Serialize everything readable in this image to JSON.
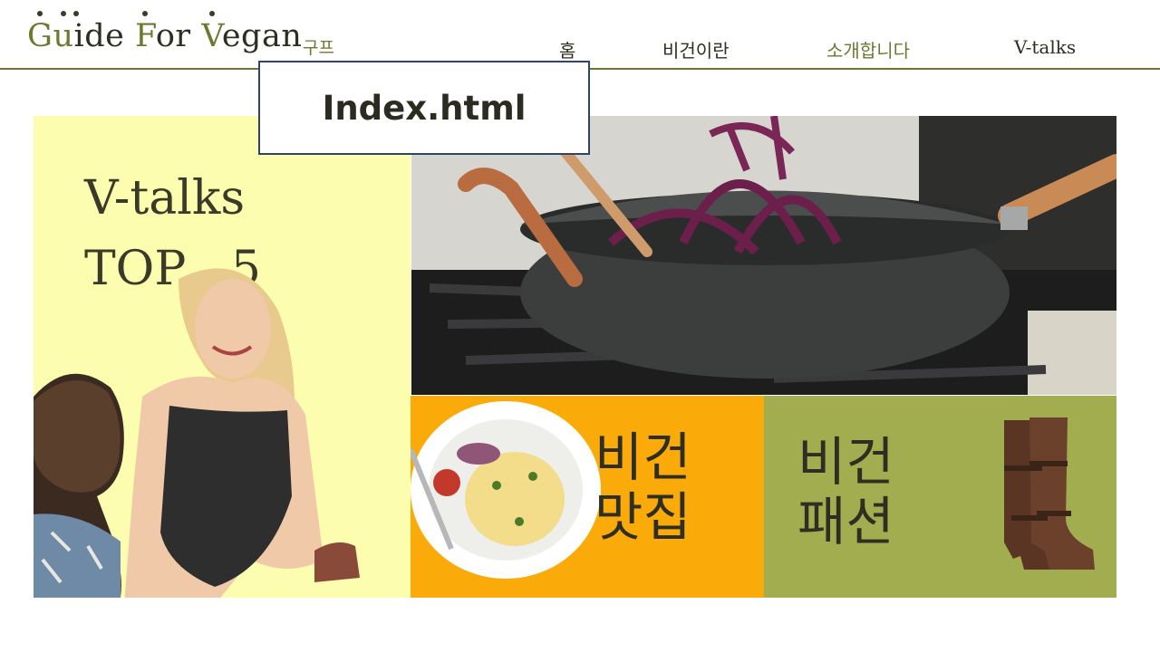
{
  "header": {
    "logo_parts": [
      "G",
      "u",
      "ide ",
      "F",
      "or ",
      "V",
      "egan"
    ],
    "logo_sub": "구프",
    "nav": [
      {
        "label": "홈"
      },
      {
        "label": "비건이란"
      },
      {
        "label": "소개합니다"
      },
      {
        "label": "V-talks"
      }
    ]
  },
  "page_label": "Index.html",
  "vtalks_panel": {
    "line1": "V-talks",
    "line2": "TOP   5"
  },
  "restaurant_card": {
    "line1": "비건",
    "line2": "맛집"
  },
  "fashion_card": {
    "line1": "비건",
    "line2": "패션"
  },
  "colors": {
    "accent_olive": "#6b7a2f",
    "yellow_panel": "#fdfdb0",
    "orange_panel": "#fbab09",
    "olive_panel": "#a2ad4f",
    "label_border": "#2f4468"
  },
  "icons": [
    "wok-photo",
    "plate-photo",
    "boots-photo",
    "woman-photo",
    "man-photo"
  ]
}
